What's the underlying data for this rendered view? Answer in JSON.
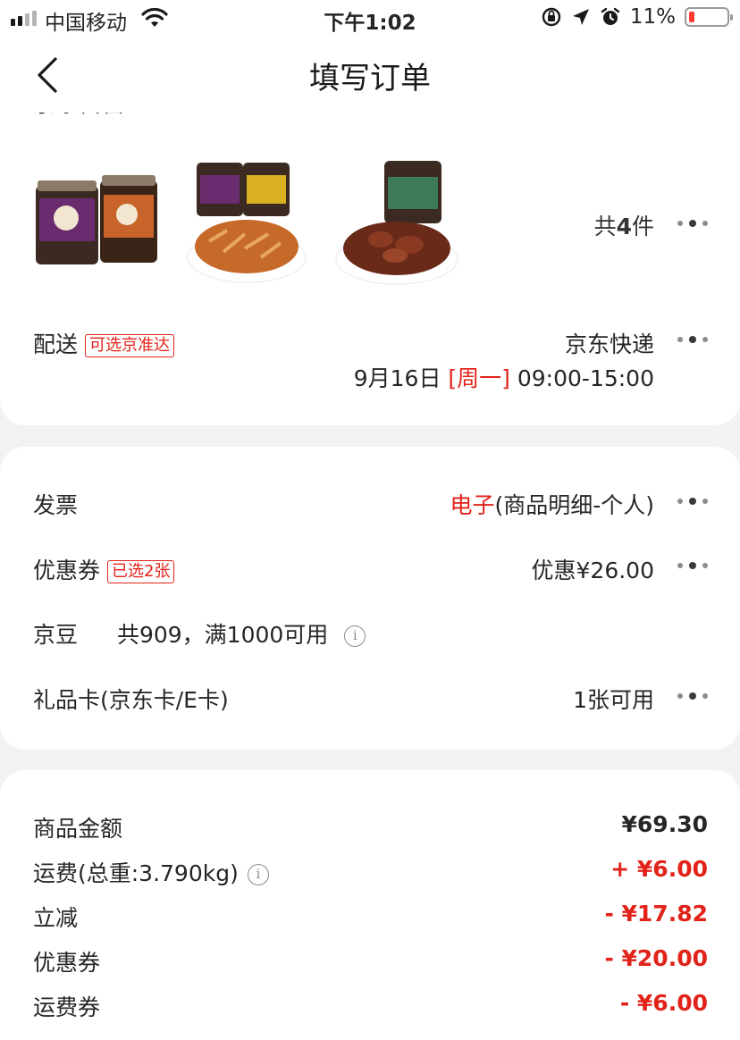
{
  "status_bar": {
    "carrier": "中国移动",
    "time": "下午1:02",
    "battery": "11%",
    "battery_level": 0.11
  },
  "nav": {
    "title": "填写订单"
  },
  "shop": {
    "name": "京东自营"
  },
  "products": {
    "count_prefix": "共",
    "count": "4",
    "count_suffix": "件",
    "items": [
      "product-jar-pair",
      "product-bamboo-shoot",
      "product-mushroom"
    ]
  },
  "delivery": {
    "label": "配送",
    "tag": "可选京准达",
    "carrier": "京东快递",
    "date": "9月16日",
    "weekday": "[周一]",
    "time_range": "09:00-15:00"
  },
  "invoice": {
    "label": "发票",
    "type": "电子",
    "detail": "(商品明细-个人)"
  },
  "coupon": {
    "label": "优惠券",
    "tag": "已选2张",
    "value": "优惠¥26.00"
  },
  "jingdou": {
    "label": "京豆",
    "info": "共909，满1000可用"
  },
  "gift_card": {
    "label": "礼品卡(京东卡/E卡)",
    "value": "1张可用"
  },
  "summary": [
    {
      "label": "商品金额",
      "value": "¥69.30",
      "color": "#262626"
    },
    {
      "label": "运费(总重:3.790kg)",
      "value": "+ ¥6.00",
      "color": "#e2231a"
    },
    {
      "label": "立减",
      "value": "- ¥17.82",
      "color": "#e2231a"
    },
    {
      "label": "优惠券",
      "value": "- ¥20.00",
      "color": "#e2231a"
    },
    {
      "label": "运费券",
      "value": "- ¥6.00",
      "color": "#e2231a"
    }
  ],
  "colors": {
    "accent": "#e2231a",
    "background": "#f2f2f2",
    "card": "#ffffff"
  }
}
